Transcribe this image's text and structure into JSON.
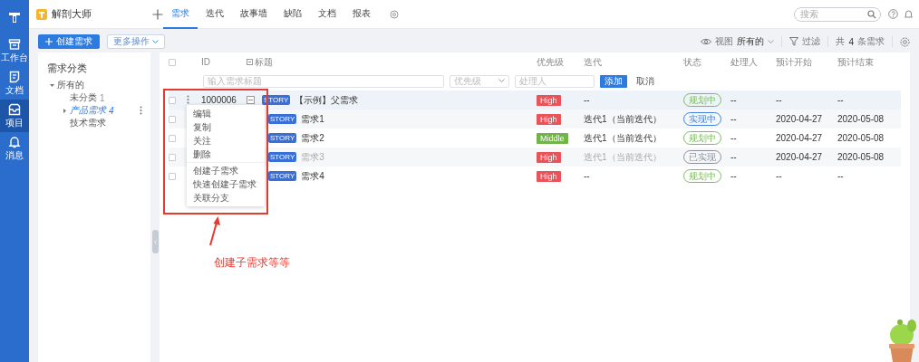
{
  "nav_rail": {
    "items": [
      {
        "label": "工作台",
        "selected": false
      },
      {
        "label": "文档",
        "selected": false
      },
      {
        "label": "项目",
        "selected": true
      },
      {
        "label": "消息",
        "selected": false
      }
    ]
  },
  "project": {
    "name": "解剖大师"
  },
  "tabs": [
    {
      "label": "需求",
      "selected": true
    },
    {
      "label": "迭代",
      "selected": false
    },
    {
      "label": "故事墙",
      "selected": false
    },
    {
      "label": "缺陷",
      "selected": false
    },
    {
      "label": "文档",
      "selected": false
    },
    {
      "label": "报表",
      "selected": false
    }
  ],
  "search": {
    "placeholder": "搜索"
  },
  "actions": {
    "create": "创建需求",
    "more": "更多操作"
  },
  "toolbar": {
    "view_label": "视图",
    "view_value": "所有的",
    "filter": "过滤",
    "count": "共**4**条需求"
  },
  "category_tree": {
    "title": "需求分类",
    "items": [
      {
        "label": "所有的",
        "expanded": true,
        "selected": false,
        "children": [
          {
            "label": "未分类",
            "count": "1",
            "selected": false
          },
          {
            "label": "产品需求",
            "count": "4",
            "selected": true,
            "expanded": false
          },
          {
            "label": "技术需求",
            "selected": false
          }
        ]
      }
    ]
  },
  "table": {
    "select_all_checked": false,
    "columns": [
      "ID",
      "标题",
      "优先级",
      "迭代",
      "状态",
      "处理人",
      "预计开始",
      "预计结束"
    ],
    "add_row": {
      "title_placeholder": "输入需求标题",
      "priority_placeholder": "优先级",
      "assignee_placeholder": "处理人",
      "add": "添加",
      "cancel": "取消"
    },
    "rows": [
      {
        "id": "1000006",
        "badge": "STORY",
        "title": "【示例】父需求",
        "checked": false,
        "menu_open": true,
        "done": false,
        "expanded": true,
        "priority": {
          "text": "High",
          "color": "#e8545a"
        },
        "iteration": "--",
        "status": {
          "text": "规划中",
          "color": "#7dbb5f"
        },
        "assignee": "--",
        "start": "--",
        "end": "--",
        "children": [
          {
            "badge": "STORY",
            "title": "需求1",
            "checked": false,
            "done": false,
            "priority": {
              "text": "High",
              "color": "#e8545a"
            },
            "iteration": "迭代1（当前迭代）",
            "status": {
              "text": "实现中",
              "color": "#3f7fe0"
            },
            "assignee": "--",
            "start": "2020-04-27",
            "end": "2020-05-08"
          },
          {
            "badge": "STORY",
            "title": "需求2",
            "checked": false,
            "done": false,
            "priority": {
              "text": "Middle",
              "color": "#72b34a"
            },
            "iteration": "迭代1（当前迭代）",
            "status": {
              "text": "规划中",
              "color": "#7dbb5f"
            },
            "assignee": "--",
            "start": "2020-04-27",
            "end": "2020-05-08"
          },
          {
            "badge": "STORY",
            "title": "需求3",
            "checked": false,
            "done": true,
            "priority": {
              "text": "High",
              "color": "#e8545a"
            },
            "iteration": "迭代1（当前迭代）",
            "status": {
              "text": "已实现",
              "color": "#8a8f99"
            },
            "assignee": "--",
            "start": "2020-04-27",
            "end": "2020-05-08"
          },
          {
            "badge": "STORY",
            "title": "需求4",
            "checked": false,
            "done": false,
            "priority": {
              "text": "High",
              "color": "#e8545a"
            },
            "iteration": "--",
            "status": {
              "text": "规划中",
              "color": "#7dbb5f"
            },
            "assignee": "--",
            "start": "--",
            "end": "--"
          }
        ]
      }
    ]
  },
  "context_menu": {
    "groups": [
      [
        "编辑",
        "复制",
        "关注",
        "删除"
      ],
      [
        "创建子需求",
        "快速创建子需求",
        "关联分支"
      ]
    ]
  },
  "annotation": {
    "text": "创建子需求等等"
  }
}
